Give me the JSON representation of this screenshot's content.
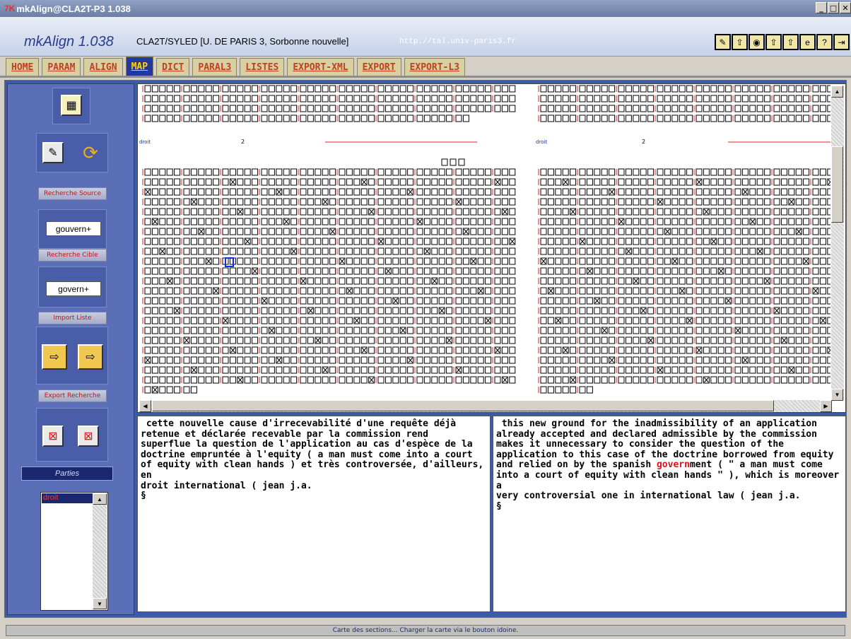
{
  "window": {
    "title": "mkAlign@CLA2T-P3 1.038",
    "icon": "7K",
    "buttons": [
      "minimize-icon",
      "maximize-icon",
      "close-icon"
    ]
  },
  "header": {
    "app_name": "mkAlign 1.038",
    "org": "CLA2T/SYLED [U. DE PARIS 3, Sorbonne nouvelle]",
    "url": "http://tal.univ-paris3.fr",
    "tool_icons": [
      {
        "name": "pencil-icon",
        "glyph": "✎"
      },
      {
        "name": "upload-icon",
        "glyph": "⇧"
      },
      {
        "name": "circle-icon",
        "glyph": "◉"
      },
      {
        "name": "upload-icon",
        "glyph": "⇧"
      },
      {
        "name": "upload-icon",
        "glyph": "⇧"
      },
      {
        "name": "browser-icon",
        "glyph": "e"
      },
      {
        "name": "help-icon",
        "glyph": "?"
      },
      {
        "name": "exit-icon",
        "glyph": "⇥"
      }
    ]
  },
  "tabs": [
    {
      "label": "HOME",
      "active": false
    },
    {
      "label": "PARAM",
      "active": false
    },
    {
      "label": "ALIGN",
      "active": false
    },
    {
      "label": "MAP",
      "active": true
    },
    {
      "label": "DICT",
      "active": false
    },
    {
      "label": "PARAL3",
      "active": false
    },
    {
      "label": "LISTES",
      "active": false
    },
    {
      "label": "EXPORT-XML",
      "active": false
    },
    {
      "label": "EXPORT",
      "active": false
    },
    {
      "label": "EXPORT-L3",
      "active": false
    }
  ],
  "sidebar": {
    "source_search_label": "Recherche Source",
    "source_search_value": "gouvern+",
    "target_search_label": "Recherche Cible",
    "target_search_value": "govern+",
    "import_label": "Import Liste",
    "export_label": "Export Recherche",
    "parties_label": "Parties",
    "parties_items": [
      "droit"
    ]
  },
  "map": {
    "left_label": "droit",
    "left_num": "2",
    "right_label": "droit",
    "right_num": "2"
  },
  "source_text": {
    "text": " cette nouvelle cause d'irrecevabilité d'une requête déjà\nretenue et déclarée recevable par la commission rend\nsuperflue la question de l'application au cas d'espèce de la\ndoctrine empruntée à l'equity ( a man must come into a court\nof equity with clean hands ) et très controversée, d'ailleurs, en\ndroit international ( jean j.a.\n§"
  },
  "target_text": {
    "before": " this new ground for the inadmissibility of an application\nalready accepted and declared admissible by the commission\nmakes it unnecessary to consider the question of the\napplication to this case of the doctrine borrowed from equity\nand relied on by the spanish ",
    "highlight": "govern",
    "after": "ment ( \" a man must come\ninto a court of equity with clean hands \" ), which is moreover a\nvery controversial one in international law ( jean j.a.\n§"
  },
  "status": "Carte des sections... Charger la carte via le bouton idoine."
}
